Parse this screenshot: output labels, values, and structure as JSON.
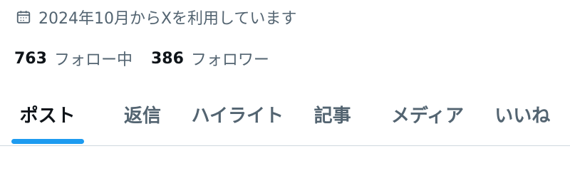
{
  "profile": {
    "joined_text": "2024年10月からXを利用しています",
    "following_count": "763",
    "following_label": "フォロー中",
    "followers_count": "386",
    "followers_label": "フォロワー"
  },
  "tabs": [
    {
      "label": "ポスト",
      "active": true
    },
    {
      "label": "返信",
      "active": false
    },
    {
      "label": "ハイライト",
      "active": false
    },
    {
      "label": "記事",
      "active": false
    },
    {
      "label": "メディア",
      "active": false
    },
    {
      "label": "いいね",
      "active": false
    }
  ],
  "icons": {
    "joined": "calendar-icon"
  },
  "colors": {
    "accent": "#1d9bf0",
    "text_primary": "#0f1419",
    "text_secondary": "#536471",
    "divider": "#cfd9de"
  }
}
